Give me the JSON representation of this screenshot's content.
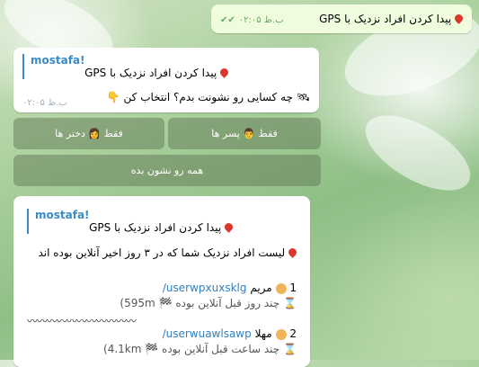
{
  "outgoing": {
    "text": "پیدا کردن افراد نزدیک با GPS",
    "time": "ب.ظ ۰۲:۰۵"
  },
  "msg1": {
    "reply_name": "mostafa!",
    "reply_text": "پیدا کردن افراد نزدیک با GPS",
    "text": "چه کسایی رو نشونت بدم؟ انتخاب کن",
    "time": "ب.ظ ۰۲:۰۵"
  },
  "keyboard": {
    "boys": "فقط 👨 پسر ها",
    "girls": "فقط 👩 دختر ها",
    "all": "همه رو نشون بده"
  },
  "msg2": {
    "reply_name": "mostafa!",
    "reply_text": "پیدا کردن افراد نزدیک با GPS",
    "header": "لیست افراد نزدیک شما که در ۳ روز اخیر آنلاین بوده اند",
    "users": [
      {
        "num": "1",
        "name": "مریم",
        "link": "/userwpxuxsklg",
        "seen": "چند روز قبل آنلاین بوده",
        "dist": "(595m"
      },
      {
        "num": "2",
        "name": "مهلا",
        "link": "/userwuawlsawp",
        "seen": "چند ساعت قبل آنلاین بوده",
        "dist": "(4.1km"
      }
    ],
    "divider": "〰〰〰〰〰〰〰〰〰〰〰"
  }
}
